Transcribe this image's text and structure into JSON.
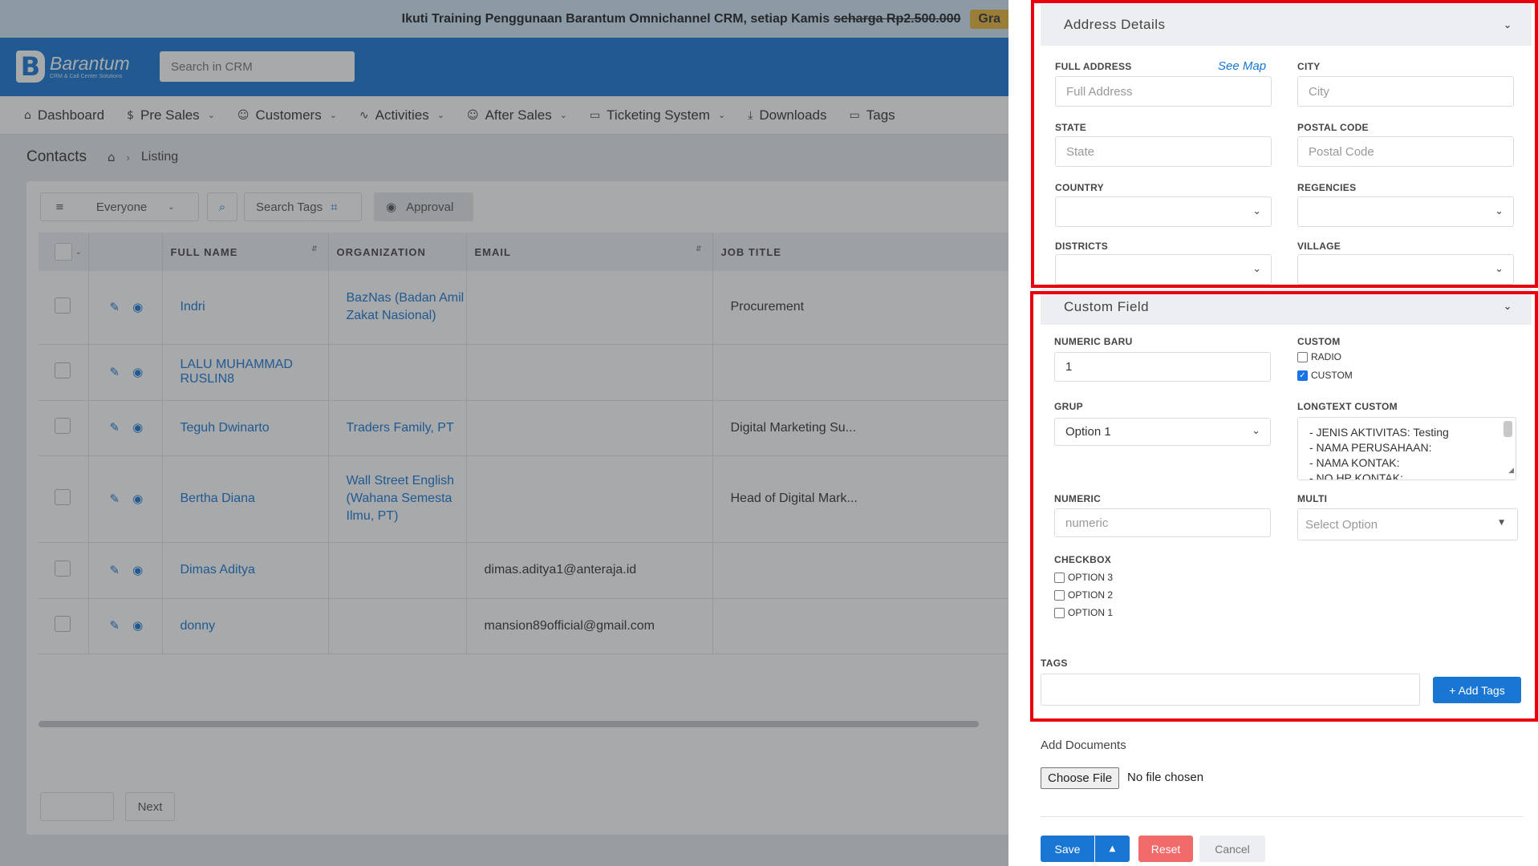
{
  "banner": {
    "text": "Ikuti Training Penggunaan Barantum Omnichannel CRM, setiap Kamis",
    "strike_price": "seharga Rp2.500.000",
    "free_label": "Gra"
  },
  "brand": {
    "logo_letter": "B",
    "name": "Barantum",
    "tagline": "CRM & Call Center Solutions"
  },
  "search": {
    "placeholder": "Search in CRM"
  },
  "nav": {
    "items": [
      {
        "label": "Dashboard",
        "icon": "home-icon",
        "glyph": "⌂",
        "dropdown": false
      },
      {
        "label": "Pre Sales",
        "icon": "dollar-icon",
        "glyph": "$",
        "dropdown": true
      },
      {
        "label": "Customers",
        "icon": "users-icon",
        "glyph": "☺",
        "dropdown": true
      },
      {
        "label": "Activities",
        "icon": "activity-icon",
        "glyph": "∿",
        "dropdown": true
      },
      {
        "label": "After Sales",
        "icon": "users-icon",
        "glyph": "☺",
        "dropdown": true
      },
      {
        "label": "Ticketing System",
        "icon": "folder-icon",
        "glyph": "▭",
        "dropdown": true
      },
      {
        "label": "Downloads",
        "icon": "download-icon",
        "glyph": "⤓",
        "dropdown": false
      },
      {
        "label": "Tags",
        "icon": "folder-icon",
        "glyph": "▭",
        "dropdown": false
      }
    ]
  },
  "breadcrumb": {
    "title": "Contacts",
    "current": "Listing"
  },
  "toolbar": {
    "filter_value": "Everyone",
    "search_tags": "Search Tags",
    "approval": "Approval"
  },
  "table": {
    "headers": [
      "FULL NAME",
      "ORGANIZATION",
      "EMAIL",
      "JOB TITLE"
    ],
    "rows": [
      {
        "name": "Indri",
        "org": "BazNas (Badan Amil Zakat Nasional)",
        "email": "",
        "job": "Procurement"
      },
      {
        "name": "LALU MUHAMMAD RUSLIN8",
        "org": "",
        "email": "",
        "job": ""
      },
      {
        "name": "Teguh Dwinarto",
        "org": "Traders Family, PT",
        "email": "",
        "job": "Digital Marketing Su..."
      },
      {
        "name": "Bertha Diana",
        "org": "Wall Street English (Wahana Semesta Ilmu, PT)",
        "email": "",
        "job": "Head of Digital Mark..."
      },
      {
        "name": "Dimas Aditya",
        "org": "",
        "email": "dimas.aditya1@anteraja.id",
        "job": ""
      },
      {
        "name": "donny",
        "org": "",
        "email": "mansion89official@gmail.com",
        "job": ""
      }
    ]
  },
  "pagination": {
    "prev": "",
    "next": "Next"
  },
  "address": {
    "title": "Address Details",
    "see_map": "See Map",
    "full_address": {
      "label": "FULL ADDRESS",
      "placeholder": "Full Address"
    },
    "city": {
      "label": "CITY",
      "placeholder": "City"
    },
    "state": {
      "label": "STATE",
      "placeholder": "State"
    },
    "postal": {
      "label": "POSTAL CODE",
      "placeholder": "Postal Code"
    },
    "country": {
      "label": "COUNTRY",
      "value": ""
    },
    "regencies": {
      "label": "REGENCIES",
      "value": ""
    },
    "districts": {
      "label": "DISTRICTS",
      "value": ""
    },
    "village": {
      "label": "VILLAGE",
      "value": ""
    }
  },
  "custom": {
    "title": "Custom Field",
    "numeric_baru": {
      "label": "NUMERIC BARU",
      "value": "1"
    },
    "custom_label": "CUSTOM",
    "custom_options": [
      {
        "label": "RADIO",
        "checked": false
      },
      {
        "label": "CUSTOM",
        "checked": true
      }
    ],
    "grup": {
      "label": "GRUP",
      "value": "Option 1"
    },
    "longtext": {
      "label": "LONGTEXT CUSTOM",
      "lines": [
        "- JENIS AKTIVITAS:  Testing",
        "- NAMA PERUSAHAAN:",
        "- NAMA KONTAK:",
        "- NO HP KONTAK:"
      ]
    },
    "numeric": {
      "label": "NUMERIC",
      "placeholder": "numeric"
    },
    "multi": {
      "label": "MULTI",
      "placeholder": "Select Option"
    },
    "checkbox": {
      "label": "CHECKBOX",
      "options": [
        {
          "label": "OPTION 3",
          "checked": false
        },
        {
          "label": "OPTION 2",
          "checked": false
        },
        {
          "label": "OPTION 1",
          "checked": false
        }
      ]
    },
    "tags": {
      "label": "TAGS",
      "value": "",
      "add_button": "+ Add Tags"
    }
  },
  "documents": {
    "label": "Add Documents",
    "choose_file": "Choose File",
    "no_file": "No file chosen"
  },
  "actions": {
    "save": "Save",
    "reset": "Reset",
    "cancel": "Cancel"
  },
  "colors": {
    "primary": "#1976d2",
    "highlight": "#e8000f",
    "reset": "#f26b6b",
    "banner_badge": "#e8b53a"
  }
}
